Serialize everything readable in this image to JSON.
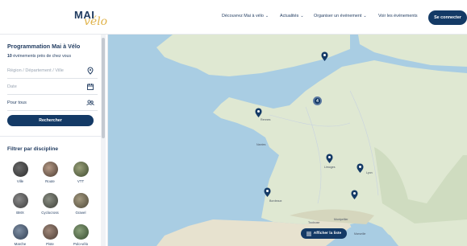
{
  "header": {
    "logo_top": "MAI",
    "logo_bottom": "vélo",
    "nav": [
      {
        "label": "Découvrez Mai à vélo",
        "has_dropdown": true
      },
      {
        "label": "Actualités",
        "has_dropdown": true
      },
      {
        "label": "Organiser un événement",
        "has_dropdown": true
      },
      {
        "label": "Voir les événements",
        "has_dropdown": false
      }
    ],
    "login_label": "Se connecter"
  },
  "sidebar": {
    "title": "Programmation Mai à Vélo",
    "count": "10",
    "count_text": "événements près de chez vous",
    "location_placeholder": "Région / Département / Ville",
    "date_placeholder": "Date",
    "audience_value": "Pour tous",
    "search_label": "Rechercher",
    "filter_title": "Filtrer par discipline",
    "disciplines": [
      "Ville",
      "Route",
      "VTT",
      "BMX",
      "Cyclocross",
      "Gravel",
      "Marche",
      "Piste",
      "Polo-vélo"
    ]
  },
  "map": {
    "cluster_count": "4",
    "list_button_label": "Afficher la liste",
    "cities": [
      "Rennes",
      "Nantes",
      "Limoges",
      "Lyon",
      "Bordeaux",
      "Toulouse",
      "Montpellier",
      "Marseille"
    ]
  },
  "colors": {
    "primary": "#143a66",
    "accent": "#e0b34a",
    "sea": "#a9cde3",
    "land": "#dfe8d2"
  }
}
